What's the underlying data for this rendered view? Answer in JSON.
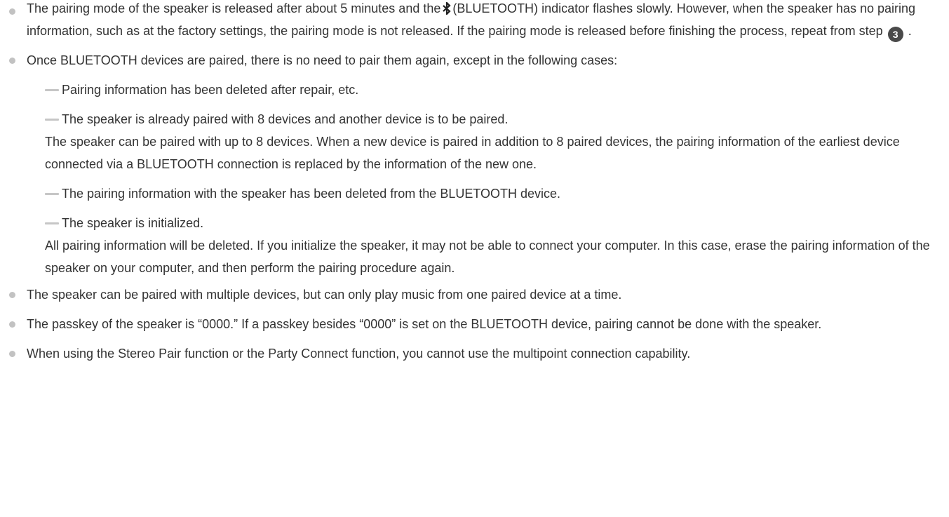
{
  "notes": [
    {
      "part1": "The pairing mode of the speaker is released after about 5 minutes and the",
      "icon_label": "(BLUETOOTH)",
      "part2": " indicator flashes slowly. However, when the speaker has no pairing information, such as at the factory settings, the pairing mode is not released. If the pairing mode is released before finishing the process, repeat from step",
      "step": "3",
      "part3": " ."
    },
    {
      "text": "Once BLUETOOTH devices are paired, there is no need to pair them again, except in the following cases:",
      "cases": [
        {
          "title": "Pairing information has been deleted after repair, etc.",
          "detail": ""
        },
        {
          "title": "The speaker is already paired with 8 devices and another device is to be paired.",
          "detail": "The speaker can be paired with up to 8 devices. When a new device is paired in addition to 8 paired devices, the pairing information of the earliest device connected via a BLUETOOTH connection is replaced by the information of the new one."
        },
        {
          "title": "The pairing information with the speaker has been deleted from the BLUETOOTH device.",
          "detail": ""
        },
        {
          "title": "The speaker is initialized.",
          "detail": "All pairing information will be deleted. If you initialize the speaker, it may not be able to connect your computer. In this case, erase the pairing information of the speaker on your computer, and then perform the pairing procedure again."
        }
      ]
    },
    {
      "text": "The speaker can be paired with multiple devices, but can only play music from one paired device at a time."
    },
    {
      "text": "The passkey of the speaker is “0000.” If a passkey besides “0000” is set on the BLUETOOTH device, pairing cannot be done with the speaker."
    },
    {
      "text": "When using the Stereo Pair function or the Party Connect function, you cannot use the multipoint connection capability."
    }
  ],
  "icons": {
    "bluetooth": "bluetooth-icon",
    "bullet": "bullet-icon",
    "dash": "dash-icon",
    "step_badge": "step-number-badge"
  },
  "colors": {
    "text": "#333333",
    "bullet": "#c2c2c2",
    "badge": "#4a4a4a"
  }
}
